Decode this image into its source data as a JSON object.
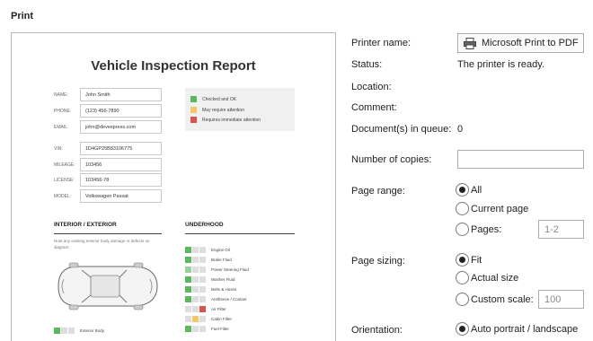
{
  "dialog": {
    "title": "Print"
  },
  "report": {
    "title": "Vehicle Inspection Report",
    "fields": [
      {
        "label": "NAME:",
        "value": "John Smith"
      },
      {
        "label": "PHONE:",
        "value": "(123) 456-7890"
      },
      {
        "label": "EMAIL:",
        "value": "john@devexpress.com"
      },
      {
        "label": "VIN:",
        "value": "1D4GP25B83106775"
      },
      {
        "label": "MILEAGE:",
        "value": "103456"
      },
      {
        "label": "LICENSE:",
        "value": "103456-78"
      },
      {
        "label": "MODEL:",
        "value": "Volkswagen Passat"
      }
    ],
    "legend": [
      {
        "text": "Checked and OK",
        "color": "#5cb85c"
      },
      {
        "text": "May require attention",
        "color": "#f2c96a"
      },
      {
        "text": "Requires immediate attention",
        "color": "#d9534f"
      }
    ],
    "interior": {
      "heading": "INTERIOR / EXTERIOR",
      "note": "Note any existing exterior body damage or defects on diagram:",
      "items": [
        "Exterior Body"
      ]
    },
    "underhood": {
      "heading": "UNDERHOOD",
      "items": [
        "Engine Oil",
        "Brake Fluid",
        "Power Steering Fluid",
        "Washer Fluid",
        "Belts & Hoses",
        "Antifreeze / Coolant",
        "Air Filter",
        "Cabin Filter",
        "Fuel Filter"
      ]
    }
  },
  "settings": {
    "printer_name_label": "Printer name:",
    "printer_button": "Microsoft Print to PDF",
    "status_label": "Status:",
    "status_value": "The printer is ready.",
    "location_label": "Location:",
    "comment_label": "Comment:",
    "queue_label": "Document(s) in queue:",
    "queue_value": "0",
    "copies_label": "Number of copies:",
    "copies_value": "",
    "page_range_label": "Page range:",
    "range_all": "All",
    "range_current": "Current page",
    "range_pages": "Pages:",
    "pages_placeholder": "1-2",
    "page_sizing_label": "Page sizing:",
    "sizing_fit": "Fit",
    "sizing_actual": "Actual size",
    "sizing_custom": "Custom scale:",
    "scale_placeholder": "100",
    "orientation_label": "Orientation:",
    "orientation_auto": "Auto portrait / landscape"
  }
}
